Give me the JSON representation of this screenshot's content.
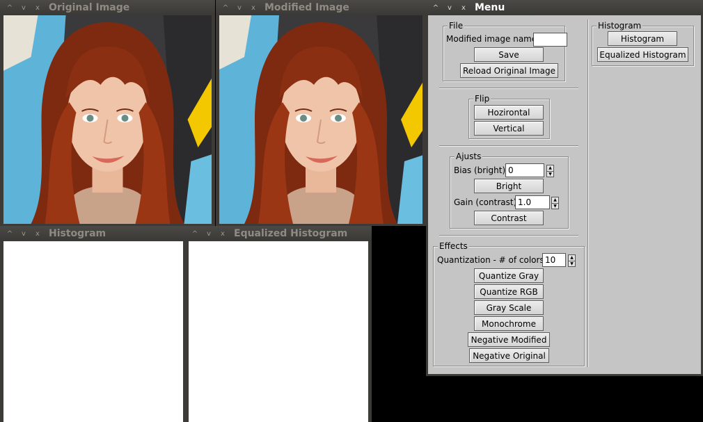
{
  "windows": {
    "original": {
      "title": "Original Image"
    },
    "modified": {
      "title": "Modified Image"
    },
    "histogram": {
      "title": "Histogram"
    },
    "equalized": {
      "title": "Equalized Histogram"
    },
    "menu": {
      "title": "Menu"
    }
  },
  "titlebar_controls": {
    "minimize": "^",
    "maximize": "v",
    "close": "x"
  },
  "menu": {
    "file": {
      "group_title": "File",
      "name_label": "Modified image name:",
      "name_value": "",
      "save": "Save",
      "reload": "Reload Original Image"
    },
    "flip": {
      "group_title": "Flip",
      "horizontal": "Hozirontal",
      "vertical": "Vertical"
    },
    "ajusts": {
      "group_title": "Ajusts",
      "bias_label": "Bias (bright):",
      "bias_value": "0",
      "bright": "Bright",
      "gain_label": "Gain (contrast):",
      "gain_value": "1.0",
      "contrast": "Contrast"
    },
    "effects": {
      "group_title": "Effects",
      "quant_label": "Quantization - # of colors:",
      "quant_value": "10",
      "quantize_gray": "Quantize Gray",
      "quantize_rgb": "Quantize RGB",
      "gray_scale": "Gray Scale",
      "monochrome": "Monochrome",
      "negative_modified": "Negative Modified",
      "negative_original": "Negative Original"
    },
    "histogram": {
      "group_title": "Histogram",
      "histogram": "Histogram",
      "equalized": "Equalized Histogram"
    }
  },
  "colors": {
    "titlebar": "#3c3b37",
    "panel": "#c5c5c5",
    "hair": "#8a2c10",
    "background_blue": "#5fb3d6"
  }
}
